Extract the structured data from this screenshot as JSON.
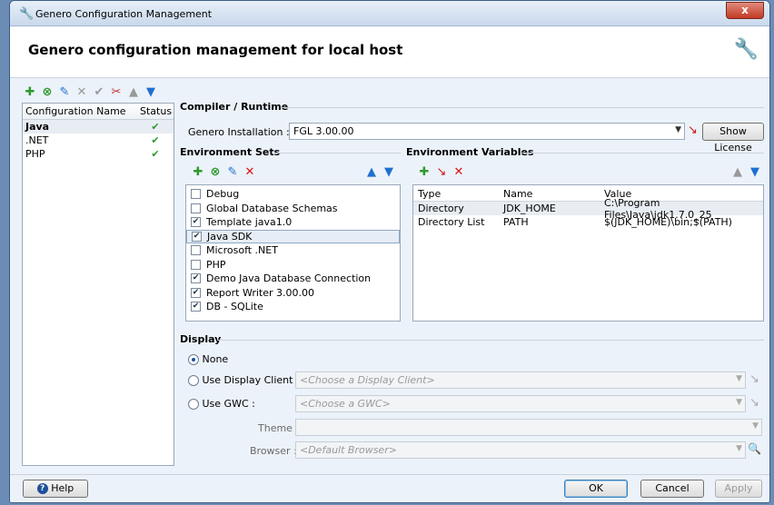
{
  "window": {
    "title": "Genero Configuration Management",
    "close": "x"
  },
  "header": {
    "title": "Genero configuration management for local host"
  },
  "configurations": {
    "columns": [
      "Configuration Name",
      "Status"
    ],
    "rows": [
      {
        "name": "Java",
        "selected": true
      },
      {
        "name": ".NET",
        "selected": false
      },
      {
        "name": "PHP",
        "selected": false
      }
    ]
  },
  "compiler": {
    "section": "Compiler / Runtime",
    "label": "Genero Installation :",
    "value": "FGL 3.00.00",
    "show_license": "Show License"
  },
  "env_sets": {
    "section": "Environment Sets",
    "items": [
      {
        "label": "Debug",
        "checked": false
      },
      {
        "label": "Global Database Schemas",
        "checked": false
      },
      {
        "label": "Template java1.0",
        "checked": true
      },
      {
        "label": "Java SDK",
        "checked": true,
        "highlight": true
      },
      {
        "label": "Microsoft .NET",
        "checked": false
      },
      {
        "label": "PHP",
        "checked": false
      },
      {
        "label": "Demo Java Database Connection",
        "checked": true
      },
      {
        "label": "Report Writer 3.00.00",
        "checked": true
      },
      {
        "label": "DB - SQLite",
        "checked": true
      }
    ]
  },
  "env_vars": {
    "section": "Environment Variables",
    "columns": [
      "Type",
      "Name",
      "Value"
    ],
    "rows": [
      {
        "type": "Directory",
        "name": "JDK_HOME",
        "value": "C:\\Program Files\\Java\\jdk1.7.0_25",
        "selected": true
      },
      {
        "type": "Directory List",
        "name": "PATH",
        "value": "$(JDK_HOME)\\bin;$(PATH)",
        "selected": false
      }
    ]
  },
  "display": {
    "section": "Display",
    "none_label": "None",
    "display_client_label": "Use Display Client :",
    "display_client_placeholder": "<Choose a Display Client>",
    "gwc_label": "Use GWC :",
    "gwc_placeholder": "<Choose a GWC>",
    "theme_label": "Theme :",
    "browser_label": "Browser :",
    "browser_placeholder": "<Default Browser>"
  },
  "footer": {
    "help": "Help",
    "ok": "OK",
    "cancel": "Cancel",
    "apply": "Apply"
  }
}
